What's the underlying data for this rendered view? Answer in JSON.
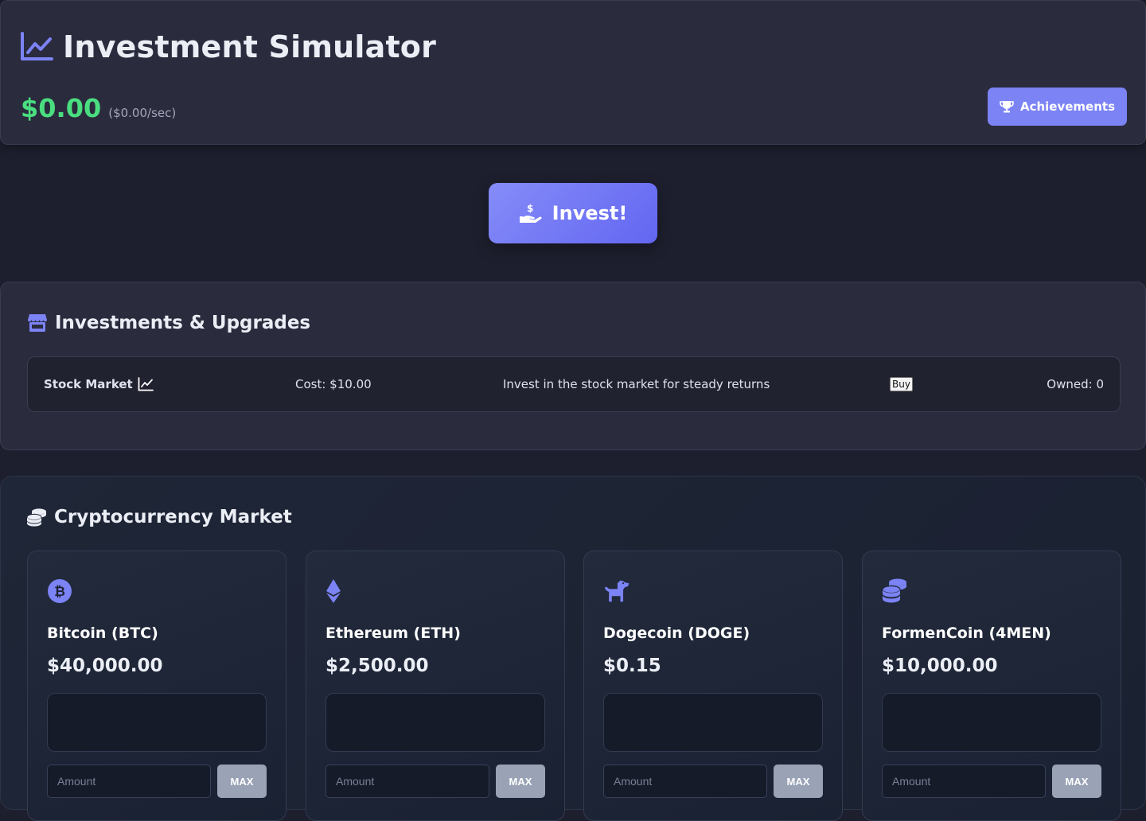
{
  "header": {
    "title": "Investment Simulator",
    "title_icon": "chart-line-icon",
    "balance": "$0.00",
    "rate": "($0.00/sec)",
    "achievements_label": "Achievements",
    "achievements_icon": "trophy-icon"
  },
  "invest": {
    "label": "Invest!",
    "icon": "hand-holding-dollar-icon"
  },
  "upgrades": {
    "title": "Investments & Upgrades",
    "icon": "store-icon",
    "items": [
      {
        "name": "Stock Market",
        "name_icon": "chart-line-icon",
        "cost": "Cost: $10.00",
        "description": "Invest in the stock market for steady returns",
        "buy_label": "Buy",
        "owned": "Owned: 0"
      }
    ]
  },
  "crypto": {
    "title": "Cryptocurrency Market",
    "icon": "coins-icon",
    "coins": [
      {
        "name": "Bitcoin (BTC)",
        "price": "$40,000.00",
        "icon": "bitcoin-icon",
        "amount_placeholder": "Amount",
        "max_label": "MAX"
      },
      {
        "name": "Ethereum (ETH)",
        "price": "$2,500.00",
        "icon": "ethereum-icon",
        "amount_placeholder": "Amount",
        "max_label": "MAX"
      },
      {
        "name": "Dogecoin (DOGE)",
        "price": "$0.15",
        "icon": "dog-icon",
        "amount_placeholder": "Amount",
        "max_label": "MAX"
      },
      {
        "name": "FormenCoin (4MEN)",
        "price": "$10,000.00",
        "icon": "coins-icon",
        "amount_placeholder": "Amount",
        "max_label": "MAX"
      }
    ]
  },
  "colors": {
    "background": "#1e1f2e",
    "panel": "#2a2b3d",
    "accent": "#7c83f5",
    "balance_green": "#4ade80",
    "icon_purple": "#7c83f5"
  }
}
